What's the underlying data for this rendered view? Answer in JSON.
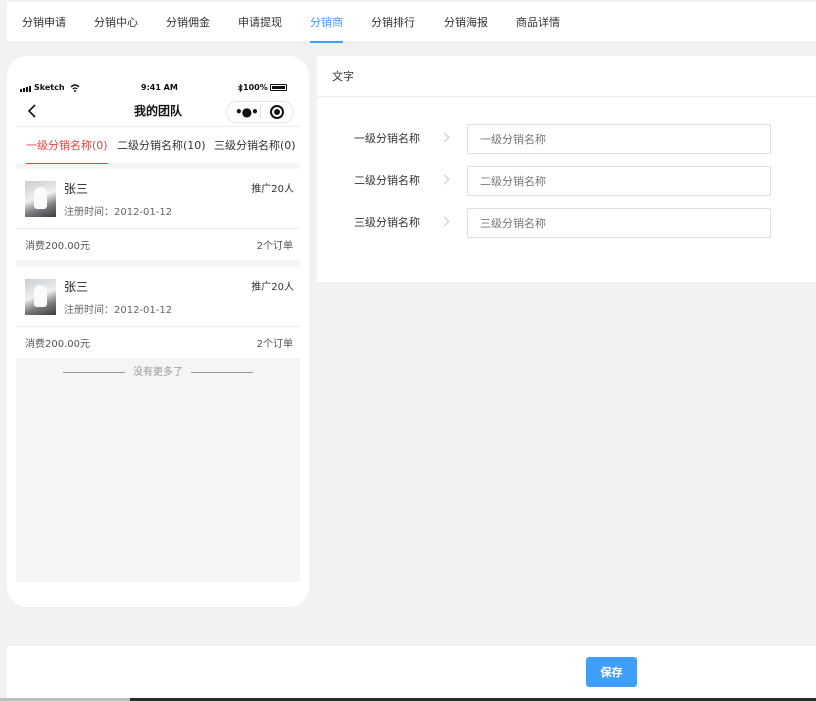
{
  "tabs": [
    "分销申请",
    "分销中心",
    "分销佣金",
    "申请提现",
    "分销商",
    "分销排行",
    "分销海报",
    "商品详情"
  ],
  "active_tab": "分销商",
  "phone": {
    "status": {
      "carrier": "Sketch",
      "time": "9:41 AM",
      "battery": "100%"
    },
    "nav_title": "我的团队",
    "level_tabs": [
      "一级分销名称(0)",
      "二级分销名称(10)",
      "三级分销名称(0)"
    ],
    "members": [
      {
        "name": "张三",
        "promo": "推广20人",
        "reg_label": "注册时间：",
        "reg_date": "2012-01-12",
        "spend": "消费200.00元",
        "orders": "2个订单"
      },
      {
        "name": "张三",
        "promo": "推广20人",
        "reg_label": "注册时间：",
        "reg_date": "2012-01-12",
        "spend": "消费200.00元",
        "orders": "2个订单"
      }
    ],
    "no_more": "没有更多了"
  },
  "panel": {
    "title": "文字",
    "fields": [
      {
        "label": "一级分销名称",
        "placeholder": "一级分销名称"
      },
      {
        "label": "二级分销名称",
        "placeholder": "二级分销名称"
      },
      {
        "label": "三级分销名称",
        "placeholder": "三级分销名称"
      }
    ]
  },
  "save_label": "保存",
  "colors": {
    "accent": "#409eff",
    "active_level": "#e64340"
  },
  "icons": {
    "back": "chevron-left-icon",
    "more": "more-dots-icon",
    "target": "record-target-icon",
    "bluetooth": "bluetooth-icon",
    "wifi": "wifi-icon"
  }
}
